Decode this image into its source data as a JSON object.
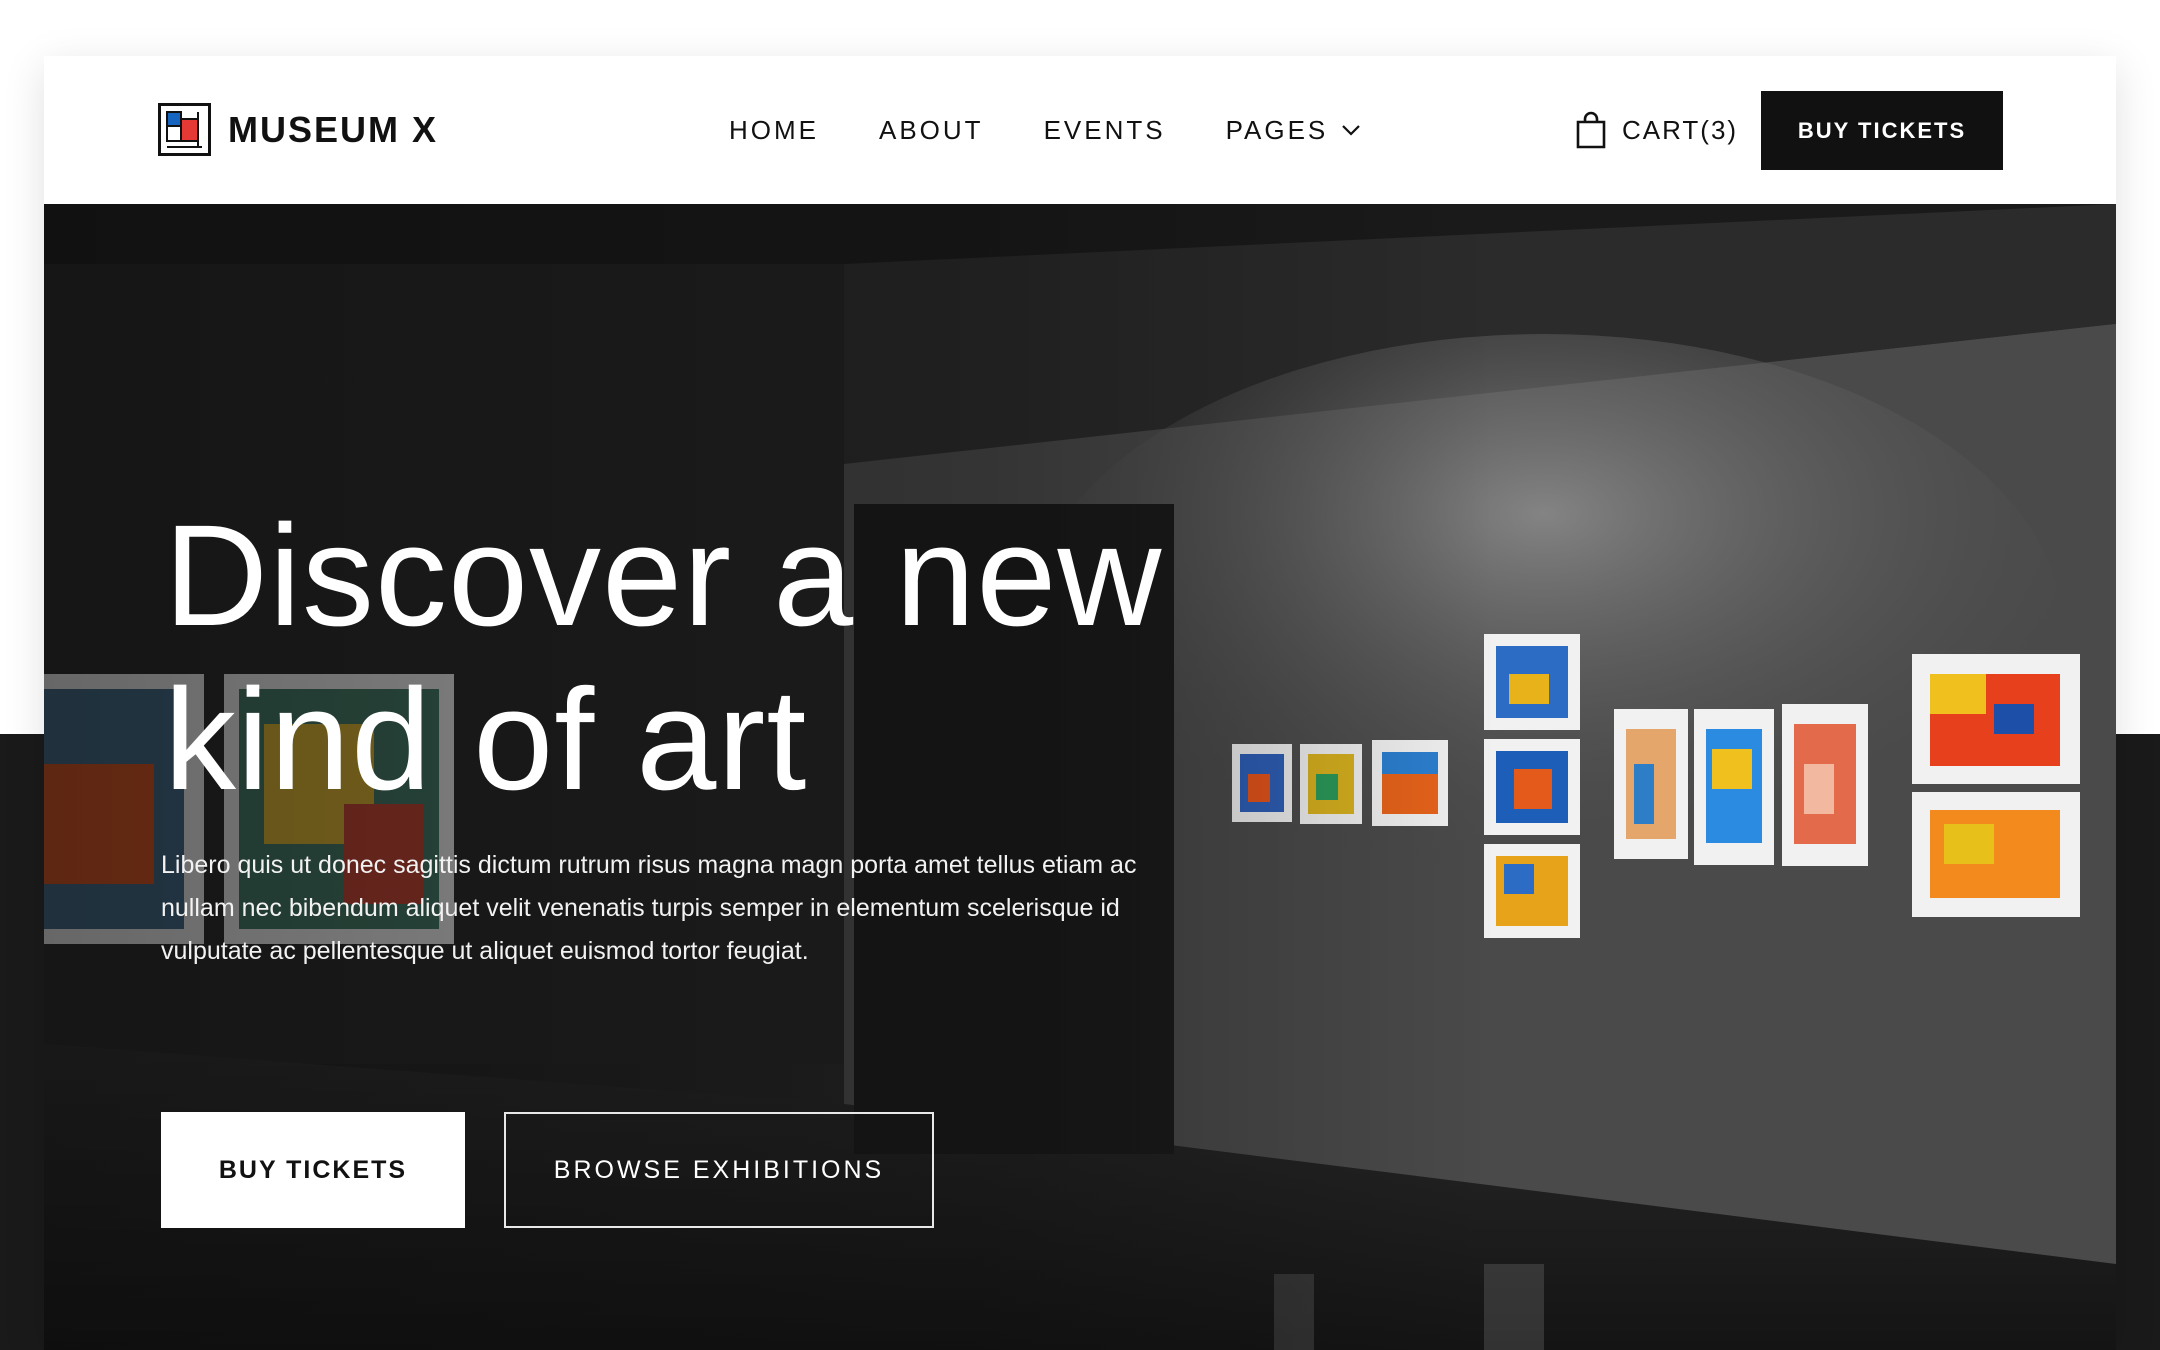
{
  "brand": {
    "name": "MUSEUM X",
    "icon": "museum-logo-icon",
    "colors": {
      "red": "#e53935",
      "blue": "#1565c0",
      "ink": "#111111"
    }
  },
  "nav": {
    "items": [
      {
        "label": "HOME"
      },
      {
        "label": "ABOUT"
      },
      {
        "label": "EVENTS"
      },
      {
        "label": "PAGES",
        "icon": "chevron-down-icon"
      }
    ],
    "cart": {
      "label": "CART(3)",
      "icon": "shopping-bag-icon"
    },
    "cta": "BUY TICKETS"
  },
  "hero": {
    "headline_line1": "Discover a new",
    "headline_line2": "kind of art",
    "description": "Libero quis ut donec sagittis dictum rutrum risus magna magn porta amet tellus etiam ac nullam nec bibendum aliquet velit venenatis turpis semper in elementum scelerisque id vulputate ac pellentesque ut aliquet euismod tortor feugiat.",
    "primary_button": "BUY TICKETS",
    "secondary_button": "BROWSE EXHIBITIONS"
  }
}
